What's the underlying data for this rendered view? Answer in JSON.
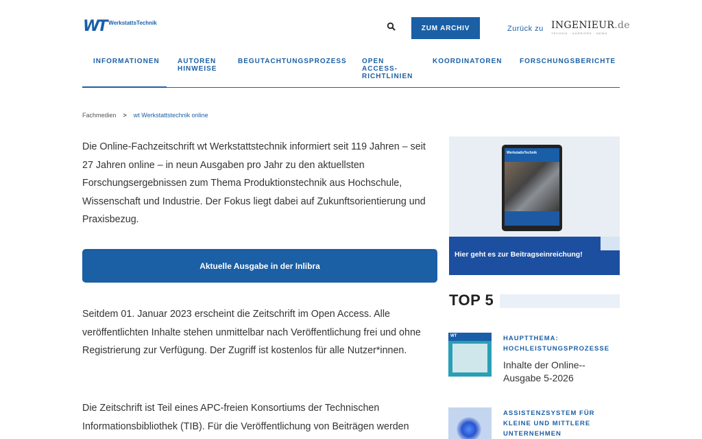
{
  "header": {
    "logo_mark": "WT",
    "logo_text": "WerkstattsTechnik",
    "archive_button": "ZUM ARCHIV",
    "back_label": "Zurück zu",
    "partner_logo_main": "INGENIEUR",
    "partner_logo_tld": ".de",
    "partner_logo_sub": "TECHNIK · KARRIERE · NEWS"
  },
  "nav": {
    "items": [
      {
        "label": "INFORMATIONEN"
      },
      {
        "label_line1": "AUTOREN",
        "label_line2": "HINWEISE"
      },
      {
        "label": "BEGUTACHTUNGSPROZESS"
      },
      {
        "label_line1": "OPEN",
        "label_line2": "ACCESS-",
        "label_line3": "RICHTLINIEN"
      },
      {
        "label": "KOORDINATOREN"
      },
      {
        "label": "FORSCHUNGSBERICHTE"
      }
    ]
  },
  "breadcrumb": {
    "root": "Fachmedien",
    "separator": ">",
    "current": "wt Werkstattstechnik online"
  },
  "main": {
    "intro": "Die Online-Fachzeitschrift wt Werkstattstechnik informiert seit 119 Jahren – seit 27 Jahren online – in neun Ausgaben pro Jahr zu den aktuellsten Forschungsergebnissen zum Thema Produktionstechnik aus Hochschule, Wissenschaft und Industrie. Der Fokus liegt dabei auf Zukunftsorientierung und Praxisbezug.",
    "cta_label": "Aktuelle Ausgabe in der Inlibra",
    "open_access": "Seitdem 01. Januar 2023 erscheint die Zeitschrift im Open Access. Alle veröffentlichten Inhalte stehen unmittelbar nach Veröffentlichung frei und ohne Registrierung zur Verfügung. Der Zugriff ist kostenlos für alle Nutzer*innen.",
    "consortium": "Die Zeitschrift ist Teil eines APC-freien Konsortiums der Technischen Informationsbibliothek (TIB). Für die Veröffentlichung von Beiträgen werden"
  },
  "sidebar": {
    "banner_text": "Hier geht es zur Beitragseinreichung!",
    "banner_tablet_head": "WerkstattsTechnik",
    "top5_title": "TOP 5",
    "items": [
      {
        "category_line1": "HAUPTTHEMA:",
        "category_line2": "HOCHLEISTUNGSPROZESSE",
        "title": "Inhalte der Online-- Ausgabe 5-2026",
        "thumb_label": "WT"
      },
      {
        "category_line1": "ASSISTENZSYSTEM FÜR",
        "category_line2": "KLEINE UND MITTLERE",
        "category_line3": "UNTERNEHMEN"
      }
    ]
  },
  "colors": {
    "brand_blue": "#1b5fa5",
    "banner_blue": "#1d4fa0",
    "text": "#333333"
  },
  "icons": {
    "search": "search-icon",
    "breadcrumb_separator": "chevron-right-icon"
  }
}
